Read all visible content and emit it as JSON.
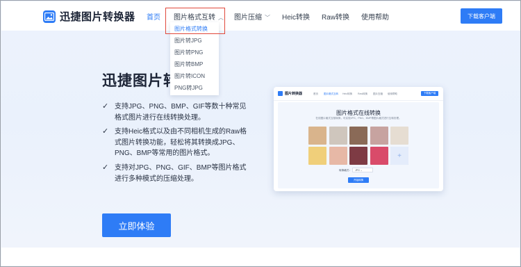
{
  "header": {
    "logo_text": "迅捷图片转换器",
    "nav": [
      {
        "label": "首页",
        "active": true
      },
      {
        "label": "图片格式互转",
        "chevron": "chevron-up-icon"
      },
      {
        "label": "图片压缩",
        "chevron": "chevron-down-icon"
      },
      {
        "label": "Heic转换"
      },
      {
        "label": "Raw转换"
      },
      {
        "label": "使用帮助"
      }
    ],
    "download_button": "下载客户端"
  },
  "dropdown": {
    "items": [
      {
        "label": "图片格式转换",
        "active": true
      },
      {
        "label": "图片转JPG"
      },
      {
        "label": "图片转PNG"
      },
      {
        "label": "图片转BMP"
      },
      {
        "label": "图片转ICON"
      },
      {
        "label": "PNG转JPG"
      }
    ]
  },
  "hero": {
    "title": "迅捷图片转",
    "features": [
      {
        "icon": "check-icon",
        "lines": [
          "支持JPG、PNG、BMP、GIF等数十种常见",
          "格式图片进行在线转换处理。"
        ]
      },
      {
        "icon": "check-icon",
        "lines": [
          "支持Heic格式以及由不同相机生成的Raw格",
          "式图片转换功能，轻松将其转换成JPG、",
          "PNG、BMP等常用的图片格式。"
        ]
      },
      {
        "icon": "check-icon",
        "lines": [
          "支持对JPG、PNG、GIF、BMP等图片格式",
          "进行多种模式的压缩处理。"
        ]
      }
    ],
    "cta": "立即体验"
  },
  "preview": {
    "logo_text": "图片转换器",
    "nav": [
      {
        "label": "首页"
      },
      {
        "label": "图片格式互转",
        "active": true
      },
      {
        "label": "Heic转换"
      },
      {
        "label": "Raw转换"
      },
      {
        "label": "图片压缩"
      },
      {
        "label": "使用帮助"
      }
    ],
    "download_button": "下载客户端",
    "title": "图片格式在线转换",
    "subtitle": "在线图片格式互相转换，可实现JPG、PNG、BMP等图片格式进行互转处理。",
    "format_label": "转换格式：",
    "format_value": "JPG",
    "convert_button": "开始转换",
    "thumb_colors": [
      "#d9b48c",
      "#cfc6bd",
      "#8a6a57",
      "#c7a3a0",
      "#e6ddd2",
      "#f0cf7a",
      "#e7b8a6",
      "#7e3b44",
      "#d94b6a",
      "#b9bec4"
    ]
  },
  "colors": {
    "accent": "#2e7cf6",
    "highlight_border": "#e0473a",
    "text_dark": "#1c2436"
  }
}
